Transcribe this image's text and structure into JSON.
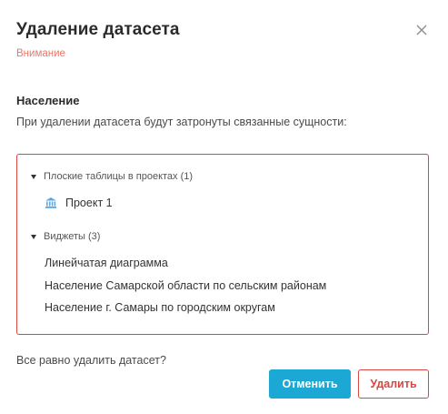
{
  "dialog": {
    "title": "Удаление датасета",
    "warning": "Внимание",
    "dataset_name": "Население",
    "description": "При удалении датасета будут затронуты связанные сущности:",
    "confirm_question": "Все равно удалить датасет?"
  },
  "groups": {
    "tables": {
      "label": "Плоские таблицы в проектах (1)",
      "items": [
        {
          "label": "Проект 1",
          "icon": "bank-building-icon"
        }
      ]
    },
    "widgets": {
      "label": "Виджеты (3)",
      "items": [
        {
          "label": "Линейчатая диаграмма"
        },
        {
          "label": "Население Самарской области по сельским районам"
        },
        {
          "label": "Население г. Самары по городским округам"
        }
      ]
    }
  },
  "buttons": {
    "cancel_label": "Отменить",
    "delete_label": "Удалить"
  },
  "colors": {
    "accent": "#1ba8d4",
    "danger": "#d9463f",
    "warning_text": "#e8776b"
  },
  "icons": {
    "close": "close-icon",
    "caret": "caret-down-icon",
    "project": "bank-building-icon"
  }
}
